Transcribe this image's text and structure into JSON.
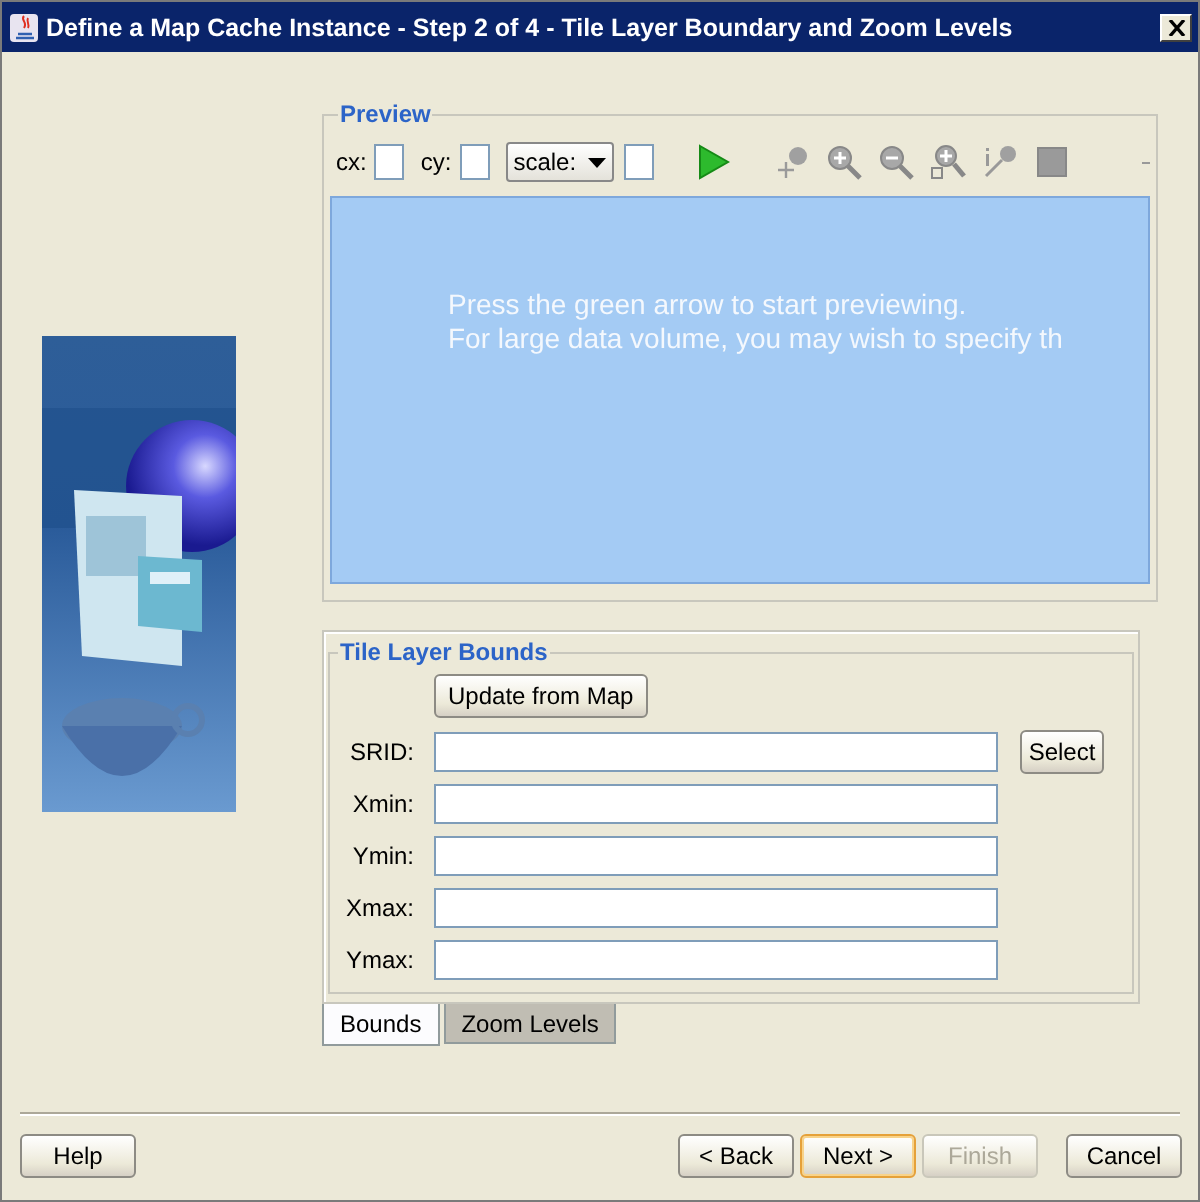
{
  "window": {
    "title": "Define a Map Cache Instance - Step 2 of 4 - Tile Layer Boundary and Zoom Levels"
  },
  "preview": {
    "title": "Preview",
    "coordinates": [
      {
        "label": "cx:"
      },
      {
        "label": "cy:"
      }
    ],
    "scale": {
      "value": "scale:"
    },
    "tools": [
      {
        "kind": "play"
      },
      {
        "kind": "pan"
      },
      {
        "kind": "zoom-in"
      },
      {
        "kind": "zoom-out"
      },
      {
        "kind": "zoom-rect"
      },
      {
        "kind": "identify"
      },
      {
        "kind": "stop"
      }
    ],
    "message": [
      "Press the green arrow to start previewing.",
      "For large data volume, you may wish to specify th"
    ]
  },
  "bounds": {
    "title": "Tile Layer Bounds",
    "update_button": "Update from Map",
    "fields": [
      {
        "label": "SRID:",
        "button": "Select"
      },
      {
        "label": "Xmin:"
      },
      {
        "label": "Ymin:"
      },
      {
        "label": "Xmax:"
      },
      {
        "label": "Ymax:"
      }
    ]
  },
  "tabs": [
    {
      "label": "Bounds",
      "selected": true
    },
    {
      "label": "Zoom Levels",
      "selected": false
    }
  ],
  "buttons": [
    {
      "label": "Help",
      "kind": "left",
      "default": false,
      "disabled": false
    },
    {
      "label": "< Back",
      "kind": "right",
      "default": false,
      "disabled": false
    },
    {
      "label": "Next >",
      "kind": "right",
      "default": true,
      "disabled": false
    },
    {
      "label": "Finish",
      "kind": "right",
      "default": false,
      "disabled": true
    },
    {
      "label": "Cancel",
      "kind": "right",
      "default": false,
      "disabled": false
    }
  ]
}
